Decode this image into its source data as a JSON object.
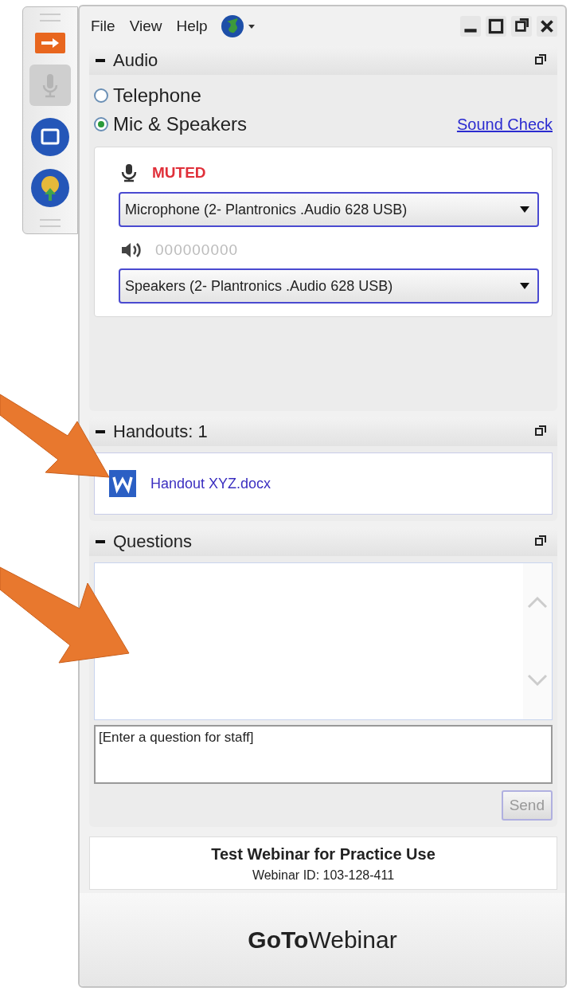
{
  "menu": [
    {
      "label": "File"
    },
    {
      "label": "View"
    },
    {
      "label": "Help"
    }
  ],
  "audio": {
    "title": "Audio",
    "expanded": true,
    "options": [
      {
        "label": "Telephone",
        "selected": false
      },
      {
        "label": "Mic & Speakers",
        "selected": true
      }
    ],
    "sound_check": "Sound Check",
    "mic_status": "MUTED",
    "microphone": "Microphone (2- Plantronics .Audio 628 USB)",
    "speaker_meter": "000000000",
    "speakers": "Speakers (2- Plantronics .Audio 628 USB)"
  },
  "handouts": {
    "title": "Handouts: 1",
    "expanded": true,
    "files": [
      {
        "name": "Handout XYZ.docx"
      }
    ]
  },
  "questions": {
    "title": "Questions",
    "expanded": true,
    "placeholder": "[Enter a question for staff]",
    "send": {
      "label": "Send",
      "disabled": true
    }
  },
  "footer": {
    "title": "Test Webinar for Practice Use",
    "webinar_id": "Webinar ID: 103-128-411",
    "logo": "**GoTo**Webinar"
  }
}
